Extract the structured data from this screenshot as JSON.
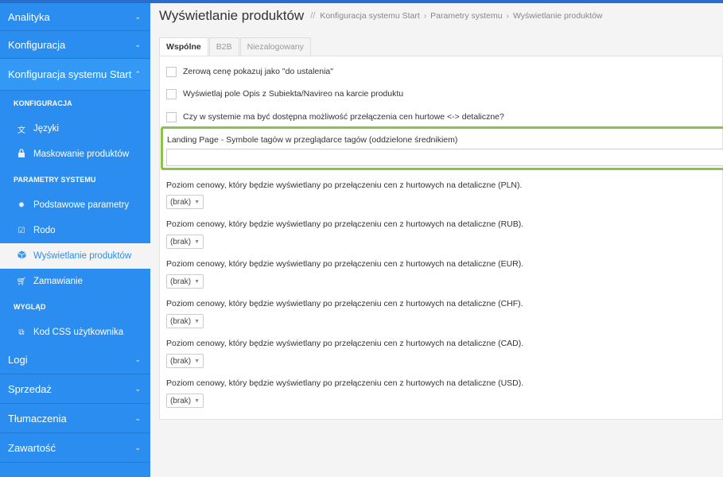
{
  "sidebar": {
    "sections_top": [
      {
        "label": "Analityka"
      },
      {
        "label": "Konfiguracja"
      },
      {
        "label": "Konfiguracja systemu Start"
      }
    ],
    "groups": {
      "konfiguracja": "KONFIGURACJA",
      "parametry": "PARAMETRY SYSTEMU",
      "wyglad": "WYGLĄD"
    },
    "items": {
      "jezyki": "Języki",
      "maskowanie": "Maskowanie produktów",
      "podstawowe": "Podstawowe parametry",
      "rodo": "Rodo",
      "wyswietlanie": "Wyświetlanie produktów",
      "zamawianie": "Zamawianie",
      "kod_css": "Kod CSS użytkownika"
    },
    "sections_bottom": [
      {
        "label": "Logi"
      },
      {
        "label": "Sprzedaż"
      },
      {
        "label": "Tłumaczenia"
      },
      {
        "label": "Zawartość"
      }
    ]
  },
  "header": {
    "title": "Wyświetlanie produktów",
    "breadcrumb": [
      "Konfiguracja systemu Start",
      "Parametry systemu",
      "Wyświetlanie produktów"
    ]
  },
  "tabs": [
    "Wspólne",
    "B2B",
    "Niezalogowany"
  ],
  "checkboxes": [
    "Zerową cenę pokazuj jako \"do ustalenia\"",
    "Wyświetlaj pole Opis z Subiekta/Navireo na karcie produktu",
    "Czy w systemie ma być dostępna możliwość przełączenia cen hurtowe <-> detaliczne?"
  ],
  "landing": {
    "label": "Landing Page - Symbole tagów w przeglądarce tagów (oddzielone średnikiem)",
    "value": ""
  },
  "price_levels": [
    {
      "label": "Poziom cenowy, który będzie wyświetlany po przełączeniu cen z hurtowych na detaliczne (PLN).",
      "value": "(brak)"
    },
    {
      "label": "Poziom cenowy, który będzie wyświetlany po przełączeniu cen z hurtowych na detaliczne (RUB).",
      "value": "(brak)"
    },
    {
      "label": "Poziom cenowy, który będzie wyświetlany po przełączeniu cen z hurtowych na detaliczne (EUR).",
      "value": "(brak)"
    },
    {
      "label": "Poziom cenowy, który będzie wyświetlany po przełączeniu cen z hurtowych na detaliczne (CHF).",
      "value": "(brak)"
    },
    {
      "label": "Poziom cenowy, który będzie wyświetlany po przełączeniu cen z hurtowych na detaliczne (CAD).",
      "value": "(brak)"
    },
    {
      "label": "Poziom cenowy, który będzie wyświetlany po przełączeniu cen z hurtowych na detaliczne (USD).",
      "value": "(brak)"
    }
  ],
  "colors": {
    "sidebar": "#2b8def",
    "highlight": "#8bc34a"
  }
}
